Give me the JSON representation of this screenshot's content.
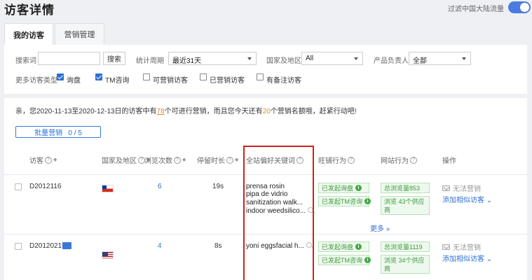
{
  "page": {
    "title": "访客详情"
  },
  "toggle": {
    "label": "过滤中国大陆流量",
    "on": true
  },
  "tabs": [
    {
      "label": "我的访客",
      "active": true
    },
    {
      "label": "营销管理",
      "active": false
    }
  ],
  "filters": {
    "search_label": "搜索词",
    "search_value": "",
    "search_button": "搜索",
    "period_label": "统计周期",
    "period_value": "最近31天",
    "country_label": "国家及地区",
    "country_value": "All",
    "owner_label": "产品负责人",
    "owner_value": "全部",
    "more_types_label": "更多访客类型",
    "checkboxes": [
      {
        "label": "询盘",
        "checked": true
      },
      {
        "label": "TM咨询",
        "checked": true
      },
      {
        "label": "可营销访客",
        "checked": false
      },
      {
        "label": "已营销访客",
        "checked": false
      },
      {
        "label": "有备注访客",
        "checked": false
      }
    ]
  },
  "notice": {
    "part1": "亲，您2020-11-13至2020-12-13日的访客中有",
    "num1": "78",
    "part2": "个可进行营销，而且您今天还有",
    "num2": "20",
    "part3": "个营销名额哦，赶紧行动吧!"
  },
  "batch_button": "批量营销   0 / 5",
  "table": {
    "headers": [
      "访客",
      "国家及地区",
      "浏览次数",
      "停留时长",
      "全站偏好关键词",
      "旺铺行为",
      "网站行为",
      "操作"
    ],
    "more_link": "更多",
    "rows": [
      {
        "visitor": "D2012116",
        "country_flag": "chile",
        "views": "6",
        "duration": "19s",
        "keywords": [
          "prensa rosin",
          "pipa de vidrio",
          "sanitization walk...",
          "indoor weedsilico..."
        ],
        "shop_actions": [
          "已发起询盘",
          "已发起TM咨询"
        ],
        "site_actions": [
          "总浏览量853",
          "浏览 43个供应商"
        ],
        "op_disabled": "无法营销",
        "op_link": "添加相似访客"
      },
      {
        "visitor": "D2012021",
        "country_flag": "usa",
        "views": "4",
        "duration": "8s",
        "keywords": [
          "yoni eggsfacial h..."
        ],
        "shop_actions": [
          "已发起询盘",
          "已发起TM咨询"
        ],
        "site_actions": [
          "总浏览量1119",
          "浏览 34个供应商"
        ],
        "op_disabled": "无法营销",
        "op_link": "添加相似访客"
      }
    ]
  },
  "colors": {
    "accent": "#2f6fd6",
    "highlight_box": "#d0201c",
    "success": "#3c9a3c",
    "notice_number": "#e08a2a"
  }
}
